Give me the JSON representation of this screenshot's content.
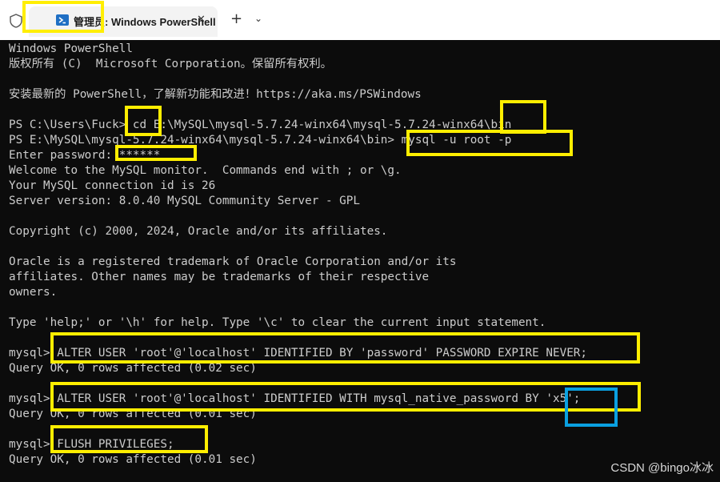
{
  "titlebar": {
    "tab_title": "管理员: Windows PowerShell",
    "close_glyph": "✕",
    "new_tab_glyph": "+",
    "dropdown_glyph": "⌄"
  },
  "terminal": {
    "lines": [
      "Windows PowerShell",
      "版权所有 (C)  Microsoft Corporation。保留所有权利。",
      "",
      "安装最新的 PowerShell，了解新功能和改进！https://aka.ms/PSWindows",
      "",
      "PS C:\\Users\\Fuck> cd E:\\MySQL\\mysql-5.7.24-winx64\\mysql-5.7.24-winx64\\bin",
      "PS E:\\MySQL\\mysql-5.7.24-winx64\\mysql-5.7.24-winx64\\bin> mysql -u root -p",
      "Enter password: ******",
      "Welcome to the MySQL monitor.  Commands end with ; or \\g.",
      "Your MySQL connection id is 26",
      "Server version: 8.0.40 MySQL Community Server - GPL",
      "",
      "Copyright (c) 2000, 2024, Oracle and/or its affiliates.",
      "",
      "Oracle is a registered trademark of Oracle Corporation and/or its",
      "affiliates. Other names may be trademarks of their respective",
      "owners.",
      "",
      "Type 'help;' or '\\h' for help. Type '\\c' to clear the current input statement.",
      "",
      "mysql> ALTER USER 'root'@'localhost' IDENTIFIED BY 'password' PASSWORD EXPIRE NEVER;",
      "Query OK, 0 rows affected (0.02 sec)",
      "",
      "mysql> ALTER USER 'root'@'localhost' IDENTIFIED WITH mysql_native_password BY 'x5';",
      "Query OK, 0 rows affected (0.01 sec)",
      "",
      "mysql> FLUSH PRIVILEGES;",
      "Query OK, 0 rows affected (0.01 sec)"
    ]
  },
  "watermark": "CSDN @bingo冰冰",
  "colors": {
    "annotation": "#ffee00",
    "annotation_alt": "#0aa0e0",
    "terminal_bg": "#0c0c0c",
    "terminal_fg": "#cccccc"
  }
}
